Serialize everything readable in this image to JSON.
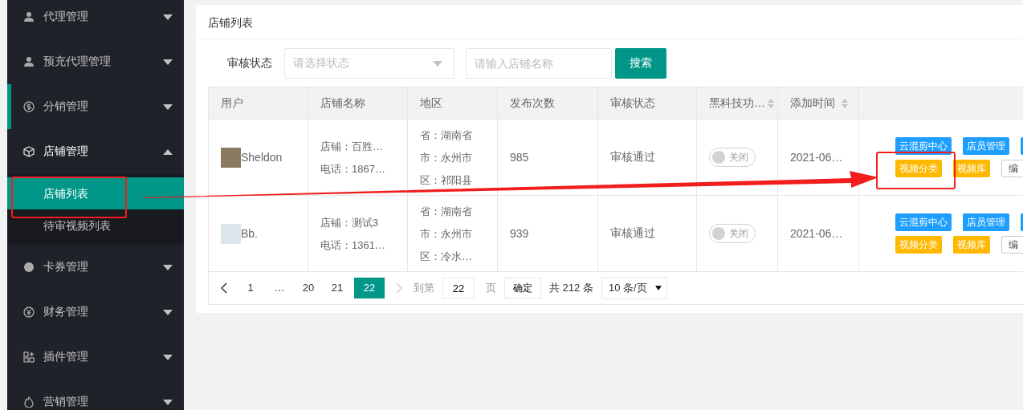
{
  "sidebar": {
    "items": [
      {
        "label": "代理管理",
        "expanded": false,
        "accent": false
      },
      {
        "label": "预充代理管理",
        "expanded": false,
        "accent": false
      },
      {
        "label": "分销管理",
        "expanded": false,
        "accent": true
      },
      {
        "label": "店铺管理",
        "expanded": true,
        "accent": false,
        "children": [
          {
            "label": "店铺列表",
            "selected": true
          },
          {
            "label": "待审视频列表",
            "selected": false
          }
        ]
      },
      {
        "label": "卡券管理",
        "expanded": false,
        "accent": false
      },
      {
        "label": "财务管理",
        "expanded": false,
        "accent": false
      },
      {
        "label": "插件管理",
        "expanded": false,
        "accent": false
      },
      {
        "label": "营销管理",
        "expanded": false,
        "accent": false
      }
    ]
  },
  "card": {
    "title": "店铺列表"
  },
  "filter": {
    "label": "审核状态",
    "select_placeholder": "请选择状态",
    "input_placeholder": "请输入店铺名称",
    "button": "搜索"
  },
  "table": {
    "columns": [
      {
        "label": "用户",
        "sortable": false
      },
      {
        "label": "店铺名称",
        "sortable": false
      },
      {
        "label": "地区",
        "sortable": false
      },
      {
        "label": "发布次数",
        "sortable": false
      },
      {
        "label": "审核状态",
        "sortable": false
      },
      {
        "label": "黑科技功…",
        "sortable": true
      },
      {
        "label": "添加时间",
        "sortable": true
      }
    ],
    "rows": [
      {
        "user": "Sheldon",
        "shop": [
          "店铺：百胜…",
          "电话：1867…"
        ],
        "region": [
          "省：湖南省",
          "市：永州市",
          "区：祁阳县"
        ],
        "count": "985",
        "status": "审核通过",
        "switch": {
          "label": "关闭",
          "on": false
        },
        "date": "2021-06…",
        "actions": [
          [
            {
              "kind": "blue",
              "label": "云混剪中心"
            },
            {
              "kind": "blue",
              "label": "店员管理"
            },
            {
              "kind": "blue"
            }
          ],
          [
            {
              "kind": "yellow",
              "label": "视频分类"
            },
            {
              "kind": "yellow",
              "label": "视频库"
            },
            {
              "kind": "plain",
              "label": "编"
            }
          ]
        ]
      },
      {
        "user": "Bb.",
        "shop": [
          "店铺：测试3",
          "电话：1361…"
        ],
        "region": [
          "省：湖南省",
          "市：永州市",
          "区：冷水…"
        ],
        "count": "939",
        "status": "审核通过",
        "switch": {
          "label": "关闭",
          "on": false
        },
        "date": "2021-06…",
        "actions": [
          [
            {
              "kind": "blue",
              "label": "云混剪中心"
            },
            {
              "kind": "blue",
              "label": "店员管理"
            },
            {
              "kind": "blue"
            }
          ],
          [
            {
              "kind": "yellow",
              "label": "视频分类"
            },
            {
              "kind": "yellow",
              "label": "视频库"
            },
            {
              "kind": "plain",
              "label": "编"
            }
          ]
        ]
      }
    ]
  },
  "pagination": {
    "pages": [
      {
        "label": "1",
        "selected": false
      },
      {
        "label": "…",
        "selected": false
      },
      {
        "label": "20",
        "selected": false
      },
      {
        "label": "21",
        "selected": false
      },
      {
        "label": "22",
        "selected": true
      }
    ],
    "goto_label": "到第",
    "goto_value": "22",
    "page_unit": "页",
    "confirm": "确定",
    "total": "共 212 条",
    "page_size": "10 条/页"
  }
}
